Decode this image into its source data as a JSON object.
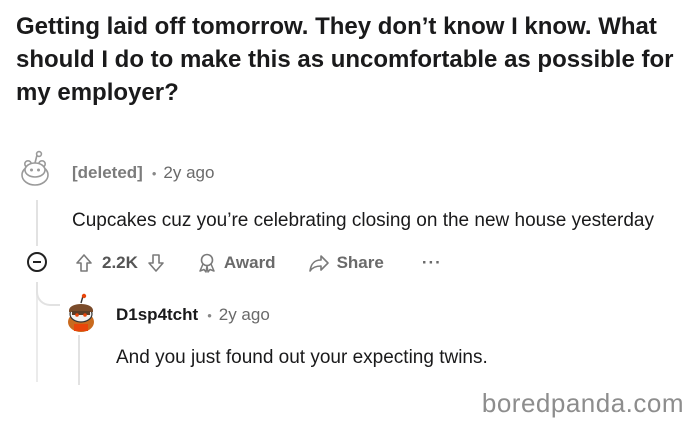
{
  "post": {
    "title": "Getting laid off tomorrow. They don’t know I know. What should I do to make this as uncomfortable as possible for my employer?"
  },
  "comments": [
    {
      "author": "[deleted]",
      "separator": "•",
      "time": "2y ago",
      "text": "Cupcakes cuz you’re celebrating closing on the new house yesterday",
      "avatar_icon": "snoo-avatar-icon",
      "actions": {
        "score": "2.2K",
        "award_label": "Award",
        "share_label": "Share",
        "more_label": "···"
      }
    },
    {
      "author": "D1sp4tcht",
      "separator": "•",
      "time": "2y ago",
      "text": "And you just found out your expecting twins.",
      "avatar_icon": "snoo-avatar-icon"
    }
  ],
  "watermark": "boredpanda.com",
  "colors": {
    "text": "#1a1a1b",
    "meta": "#6a6a6a",
    "thread_line": "#e2e2e2",
    "avatar_red": "#d93a00",
    "avatar_orange": "#ff4500"
  }
}
